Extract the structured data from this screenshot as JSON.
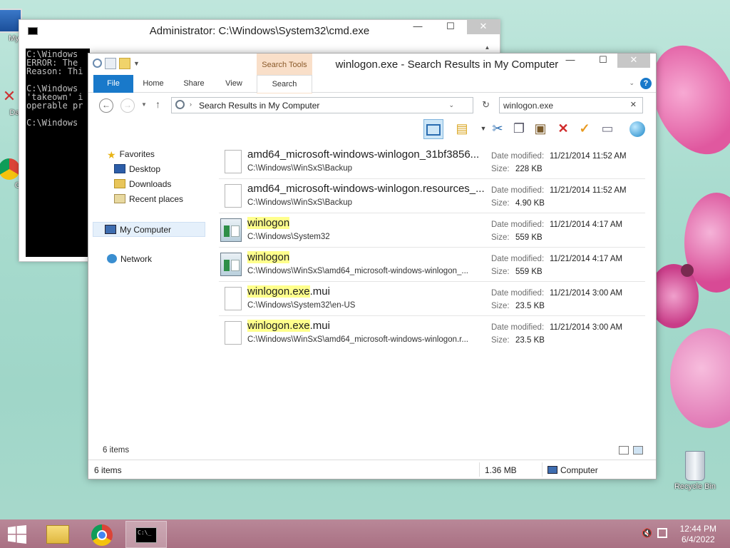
{
  "desktop": {
    "icons": [
      {
        "label": "My C",
        "icon": "computer-icon"
      },
      {
        "label": "Data",
        "icon": "data-icon"
      },
      {
        "label": "G",
        "icon": "chrome-icon"
      },
      {
        "label": "Recycle Bin",
        "icon": "recycle-bin-icon"
      }
    ]
  },
  "cmd": {
    "title": "Administrator: C:\\Windows\\System32\\cmd.exe",
    "minimize": "—",
    "maximize": "☐",
    "close": "✕",
    "console_text": "C:\\Windows\nERROR: The\nReason: Thi\n\nC:\\Windows\n'takeown' i\noperable pr\n\nC:\\Windows"
  },
  "explorer": {
    "title": "winlogon.exe - Search Results in My Computer",
    "context_tab": "Search Tools",
    "tabs": [
      "File",
      "Home",
      "Share",
      "View",
      "Search"
    ],
    "address_path": "Search Results in My Computer",
    "search_query": "winlogon.exe",
    "nav": {
      "favorites": "Favorites",
      "desktop": "Desktop",
      "downloads": "Downloads",
      "recent": "Recent places",
      "computer": "My Computer",
      "network": "Network"
    },
    "labels": {
      "modified": "Date modified:",
      "size": "Size:"
    },
    "files": [
      {
        "pre": "",
        "hl": "",
        "post": "amd64_microsoft-windows-winlogon_31bf3856...",
        "path": "C:\\Windows\\WinSxS\\Backup",
        "date": "11/21/2014 11:52 AM",
        "size": "228 KB",
        "icon": "blank-file-icon"
      },
      {
        "pre": "",
        "hl": "",
        "post": "amd64_microsoft-windows-winlogon.resources_...",
        "path": "C:\\Windows\\WinSxS\\Backup",
        "date": "11/21/2014 11:52 AM",
        "size": "4.90 KB",
        "icon": "blank-file-icon"
      },
      {
        "pre": "",
        "hl": "winlogon",
        "post": "",
        "path": "C:\\Windows\\System32",
        "date": "11/21/2014 4:17 AM",
        "size": "559 KB",
        "icon": "application-icon"
      },
      {
        "pre": "",
        "hl": "winlogon",
        "post": "",
        "path": "C:\\Windows\\WinSxS\\amd64_microsoft-windows-winlogon_...",
        "date": "11/21/2014 4:17 AM",
        "size": "559 KB",
        "icon": "application-icon"
      },
      {
        "pre": "",
        "hl": "winlogon.exe",
        "post": ".mui",
        "path": "C:\\Windows\\System32\\en-US",
        "date": "11/21/2014 3:00 AM",
        "size": "23.5 KB",
        "icon": "blank-file-icon"
      },
      {
        "pre": "",
        "hl": "winlogon.exe",
        "post": ".mui",
        "path": "C:\\Windows\\WinSxS\\amd64_microsoft-windows-winlogon.r...",
        "date": "11/21/2014 3:00 AM",
        "size": "23.5 KB",
        "icon": "blank-file-icon"
      }
    ],
    "inner_count": "6 items",
    "status_count": "6 items",
    "status_size": "1.36 MB",
    "status_location": "Computer"
  },
  "taskbar": {
    "time": "12:44 PM",
    "date": "6/4/2022"
  },
  "colors": {
    "accent": "#1979ca",
    "highlight": "#ffff8c",
    "taskbar": "#b27a8c",
    "context_tab": "#f9dfc9"
  }
}
